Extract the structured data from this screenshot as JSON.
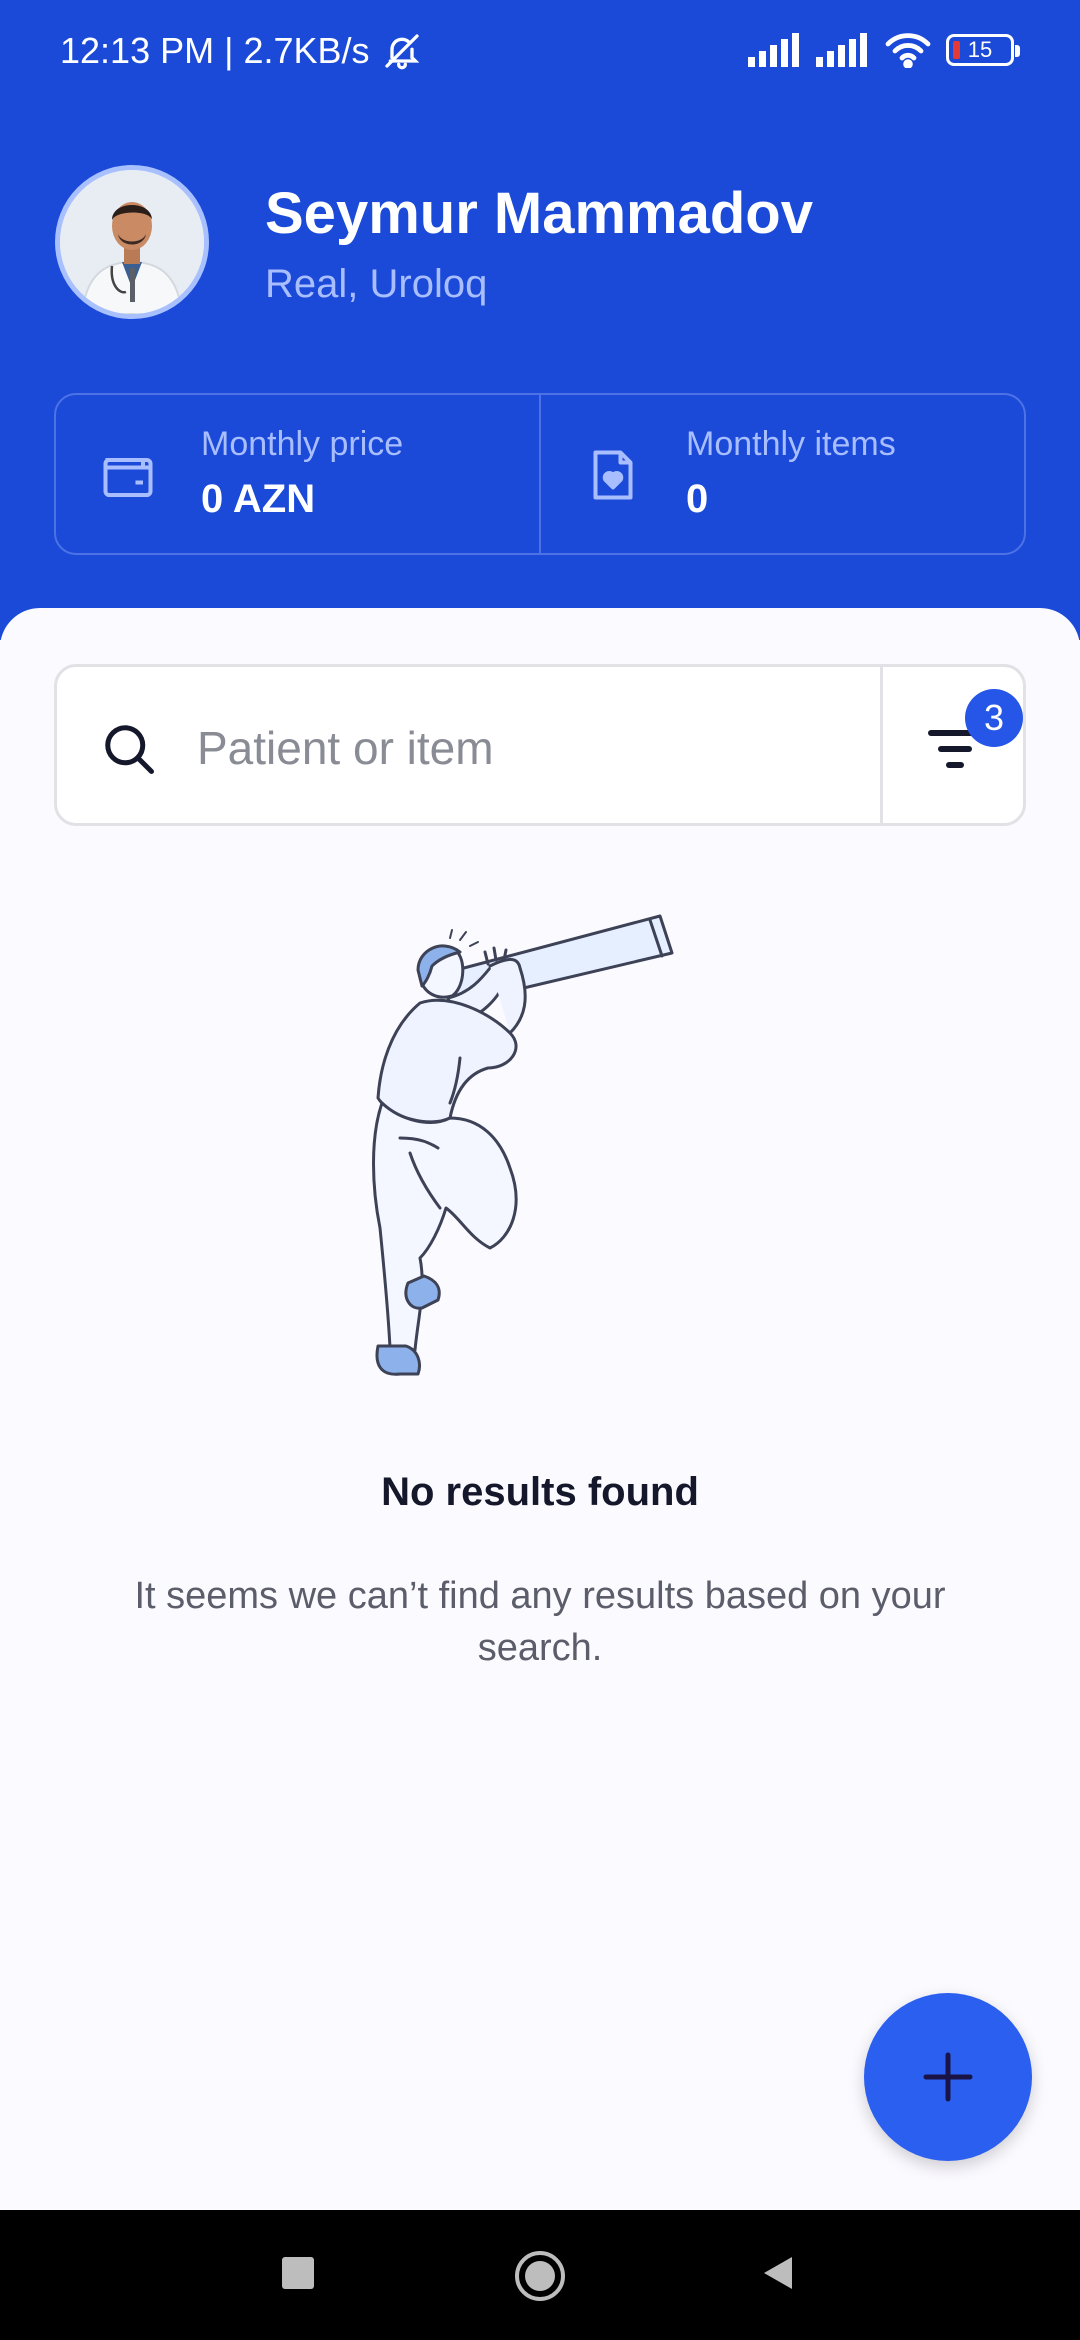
{
  "status_bar": {
    "time_speed": "12:13 PM | 2.7KB/s",
    "battery_level": "15"
  },
  "profile": {
    "name": "Seymur Mammadov",
    "role": "Real, Uroloq"
  },
  "stats": {
    "monthly_price_label": "Monthly price",
    "monthly_price_value": "0 AZN",
    "monthly_items_label": "Monthly items",
    "monthly_items_value": "0"
  },
  "search": {
    "placeholder": "Patient or item",
    "filter_count": "3"
  },
  "empty_state": {
    "title": "No results found",
    "message": "It seems we can’t find any results based on your search."
  },
  "colors": {
    "header_bg": "#1b4ad9",
    "accent": "#2a5ff0",
    "badge": "#2656e8"
  },
  "icons": {
    "bell_off": "bell-off-icon",
    "signal": "signal-icon",
    "wifi": "wifi-icon",
    "battery": "battery-icon",
    "wallet": "wallet-icon",
    "document_heart": "document-heart-icon",
    "search": "search-icon",
    "filter": "filter-icon",
    "plus": "plus-icon",
    "nav_recent": "square-icon",
    "nav_home": "circle-icon",
    "nav_back": "triangle-back-icon"
  }
}
